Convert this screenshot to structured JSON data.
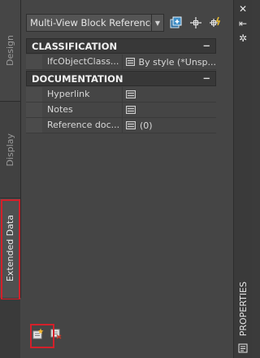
{
  "tabs": {
    "design": "Design",
    "display": "Display",
    "extended_data": "Extended Data"
  },
  "toolbar": {
    "object_type": "Multi-View Block Reference"
  },
  "categories": [
    {
      "label": "CLASSIFICATION",
      "collapse_symbol": "−",
      "rows": [
        {
          "name": "IfcObjectClass...",
          "value": "By style (*Unsp..."
        }
      ]
    },
    {
      "label": "DOCUMENTATION",
      "collapse_symbol": "−",
      "rows": [
        {
          "name": "Hyperlink",
          "value": ""
        },
        {
          "name": "Notes",
          "value": ""
        },
        {
          "name": "Reference doc...",
          "value": "(0)"
        }
      ]
    }
  ],
  "palette": {
    "title": "PROPERTIES",
    "close_symbol": "✕",
    "autohide_symbol": "⇤",
    "settings_symbol": "✲"
  },
  "colors": {
    "highlight": "#d4202a",
    "background": "#454545"
  }
}
